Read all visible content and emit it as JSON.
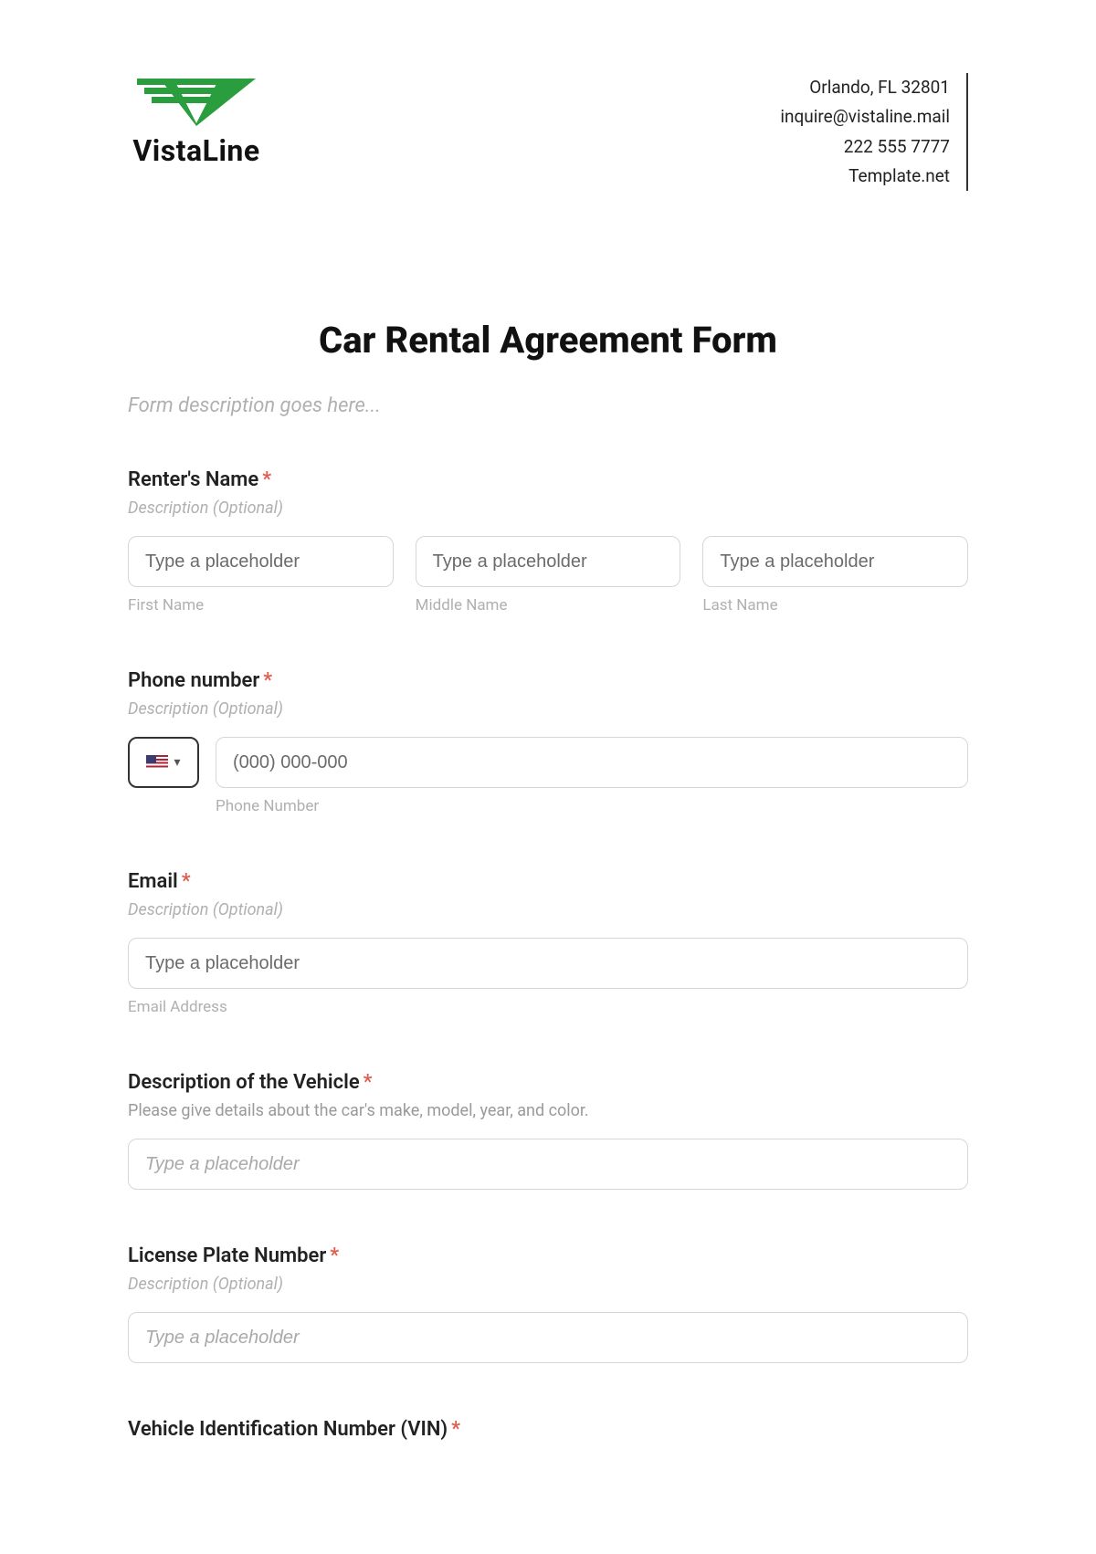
{
  "brand": {
    "name": "VistaLine"
  },
  "contact": {
    "line1": "Orlando, FL 32801",
    "line2": "inquire@vistaline.mail",
    "line3": "222 555 7777",
    "line4": "Template.net"
  },
  "form": {
    "title": "Car Rental Agreement Form",
    "description": "Form description goes here..."
  },
  "fields": {
    "renter_name": {
      "label": "Renter's Name",
      "required": "*",
      "desc": "Description (Optional)",
      "first": {
        "placeholder": "Type a placeholder",
        "sublabel": "First Name"
      },
      "middle": {
        "placeholder": "Type a placeholder",
        "sublabel": "Middle Name"
      },
      "last": {
        "placeholder": "Type a placeholder",
        "sublabel": "Last Name"
      }
    },
    "phone": {
      "label": "Phone number",
      "required": "*",
      "desc": "Description (Optional)",
      "placeholder": "(000) 000-000",
      "sublabel": "Phone Number"
    },
    "email": {
      "label": "Email",
      "required": "*",
      "desc": "Description (Optional)",
      "placeholder": "Type a placeholder",
      "sublabel": "Email Address"
    },
    "vehicle_desc": {
      "label": "Description of the Vehicle",
      "required": "*",
      "desc": "Please give details about the car's make, model, year, and color.",
      "placeholder": "Type a placeholder"
    },
    "plate": {
      "label": "License Plate Number",
      "required": "*",
      "desc": "Description (Optional)",
      "placeholder": "Type a placeholder"
    },
    "vin": {
      "label": "Vehicle Identification Number (VIN)",
      "required": "*"
    }
  }
}
